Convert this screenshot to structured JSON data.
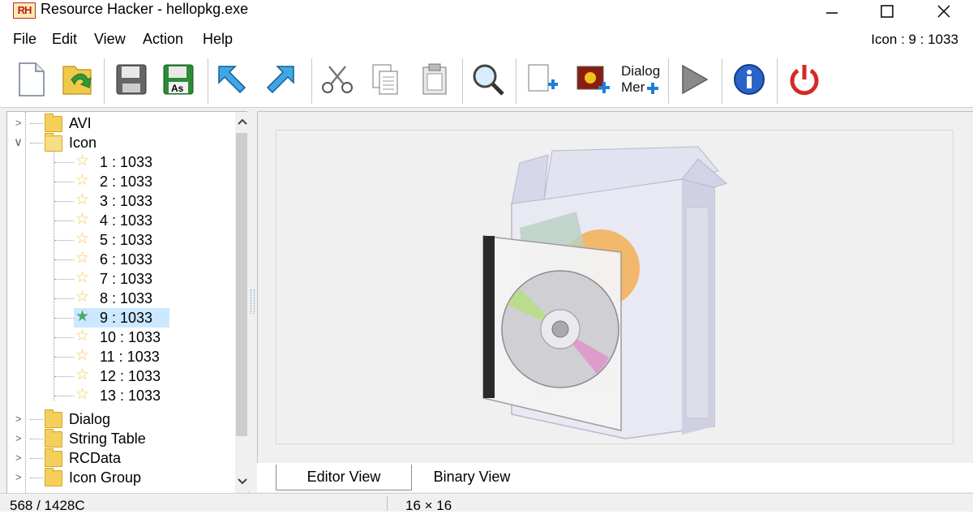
{
  "window": {
    "app_icon_label": "RH",
    "title": "Resource Hacker - hellopkg.exe"
  },
  "menu": {
    "items": [
      "File",
      "Edit",
      "View",
      "Action",
      "Help"
    ],
    "right_info": "Icon : 9 : 1033"
  },
  "toolbar": {
    "buttons": [
      {
        "name": "new-file-icon"
      },
      {
        "name": "open-file-icon"
      },
      {
        "name": "save-icon"
      },
      {
        "name": "save-as-icon",
        "label": "As"
      },
      {
        "name": "arrow-up-left-icon"
      },
      {
        "name": "arrow-up-right-icon"
      },
      {
        "name": "cut-scissors-icon"
      },
      {
        "name": "copy-icon"
      },
      {
        "name": "paste-icon"
      },
      {
        "name": "search-icon"
      },
      {
        "name": "add-blank-resource-icon"
      },
      {
        "name": "add-image-resource-icon"
      },
      {
        "name": "dialog-menu-add-icon",
        "label_line1": "Dialog",
        "label_line2": "Mer"
      },
      {
        "name": "play-icon"
      },
      {
        "name": "info-icon"
      },
      {
        "name": "power-icon"
      }
    ]
  },
  "tree": {
    "items": [
      {
        "label": "AVI",
        "type": "folder",
        "expanded": false
      },
      {
        "label": "Icon",
        "type": "folder",
        "expanded": true
      },
      {
        "label": "1 : 1033",
        "type": "icon"
      },
      {
        "label": "2 : 1033",
        "type": "icon"
      },
      {
        "label": "3 : 1033",
        "type": "icon"
      },
      {
        "label": "4 : 1033",
        "type": "icon"
      },
      {
        "label": "5 : 1033",
        "type": "icon"
      },
      {
        "label": "6 : 1033",
        "type": "icon"
      },
      {
        "label": "7 : 1033",
        "type": "icon"
      },
      {
        "label": "8 : 1033",
        "type": "icon"
      },
      {
        "label": "9 : 1033",
        "type": "icon",
        "selected": true
      },
      {
        "label": "10 : 1033",
        "type": "icon"
      },
      {
        "label": "11 : 1033",
        "type": "icon"
      },
      {
        "label": "12 : 1033",
        "type": "icon"
      },
      {
        "label": "13 : 1033",
        "type": "icon"
      },
      {
        "label": "Dialog",
        "type": "folder",
        "expanded": false
      },
      {
        "label": "String Table",
        "type": "folder",
        "expanded": false
      },
      {
        "label": "RCData",
        "type": "folder",
        "expanded": false
      },
      {
        "label": "Icon Group",
        "type": "folder",
        "expanded": false
      }
    ]
  },
  "tabs": {
    "editor": "Editor View",
    "binary": "Binary View"
  },
  "status": {
    "left": "568 / 1428C",
    "right": "16 × 16"
  },
  "colors": {
    "selection": "#cce8ff",
    "folder": "#f4cf5c",
    "star": "#f3c84a",
    "selected_star": "#4aa86a"
  }
}
